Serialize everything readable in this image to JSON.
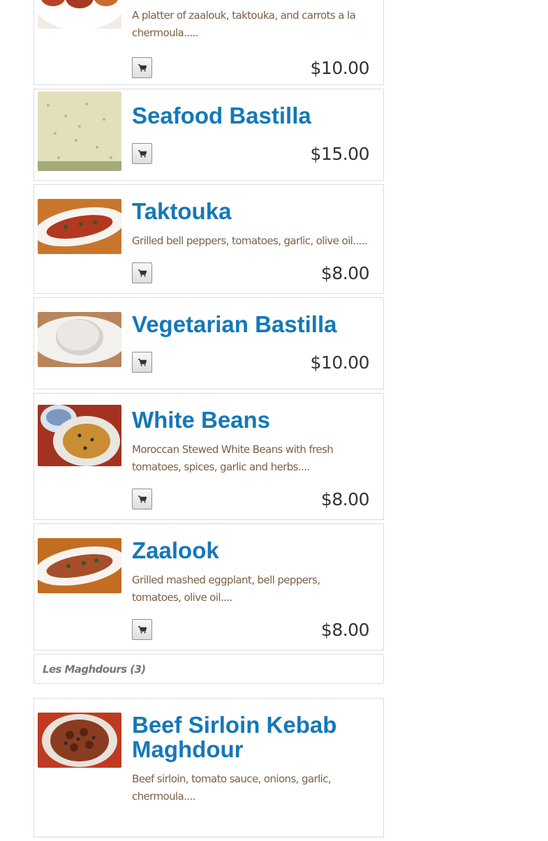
{
  "items": [
    {
      "title": "",
      "desc": "A platter of zaalouk, taktouka, and carrots a la chermoula.....",
      "price": "$10.00"
    },
    {
      "title": "Seafood Bastilla",
      "desc": "",
      "price": "$15.00"
    },
    {
      "title": "Taktouka",
      "desc": "Grilled bell peppers, tomatoes, garlic, olive oil.....",
      "price": "$8.00"
    },
    {
      "title": "Vegetarian Bastilla",
      "desc": "",
      "price": "$10.00"
    },
    {
      "title": "White Beans",
      "desc": "Moroccan Stewed White Beans with fresh tomatoes, spices, garlic and herbs....",
      "price": "$8.00"
    },
    {
      "title": "Zaalook",
      "desc": "Grilled mashed eggplant, bell peppers, tomatoes, olive oil....",
      "price": "$8.00"
    }
  ],
  "category": {
    "label": "Les Maghdours (3)"
  },
  "next_items": [
    {
      "title": "Beef Sirloin Kebab Maghdour",
      "desc": "Beef sirloin, tomato sauce, onions, garlic, chermoula...."
    }
  ],
  "icons": {
    "cart": "shopping-cart-icon"
  }
}
